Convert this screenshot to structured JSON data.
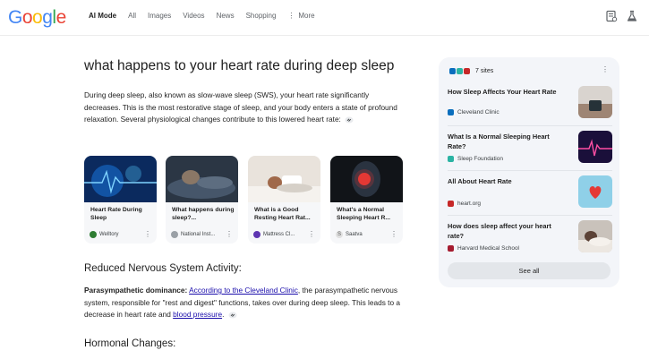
{
  "header": {
    "logo": "Google",
    "tabs": [
      {
        "label": "AI Mode",
        "active": true
      },
      {
        "label": "All"
      },
      {
        "label": "Images"
      },
      {
        "label": "Videos"
      },
      {
        "label": "News"
      },
      {
        "label": "Shopping"
      },
      {
        "label": "More"
      }
    ],
    "icons": [
      "notebook-icon",
      "labs-flask-icon"
    ]
  },
  "main": {
    "query": "what happens to your heart rate during deep sleep",
    "intro": "During deep sleep, also known as slow-wave sleep (SWS), your heart rate significantly decreases. This is the most restorative stage of sleep, and your body enters a state of profound relaxation. Several physiological changes contribute to this lowered heart rate:",
    "cards": [
      {
        "title": "Heart Rate During Sleep",
        "source": "Welltory",
        "fav_color": "#2e7d32"
      },
      {
        "title": "What happens during sleep?...",
        "source": "National Inst...",
        "fav_color": "#9aa0a6"
      },
      {
        "title": "What is a Good Resting Heart Rat...",
        "source": "Mattress Cl...",
        "fav_color": "#5e35b1"
      },
      {
        "title": "What's a Normal Sleeping Heart R...",
        "source": "Saatva",
        "fav_color": "#757575"
      }
    ],
    "section1": {
      "heading": "Reduced Nervous System Activity:",
      "bold": "Parasympathetic dominance:",
      "link1": "According to the Cleveland Clinic",
      "text1": ", the parasympathetic nervous system, responsible for \"rest and digest\" functions, takes over during deep sleep. This leads to a decrease in heart rate and ",
      "link2": "blood pressure",
      "text2": "."
    },
    "section2": {
      "heading": "Hormonal Changes:"
    }
  },
  "panel": {
    "sites_count": "7 sites",
    "sources": [
      {
        "title": "How Sleep Affects Your Heart Rate",
        "site": "Cleveland Clinic",
        "fav_color": "#0a6ebd"
      },
      {
        "title": "What Is a Normal Sleeping Heart Rate?",
        "site": "Sleep Foundation",
        "fav_color": "#2bb3a3"
      },
      {
        "title": "All About Heart Rate",
        "site": "heart.org",
        "fav_color": "#c62828"
      },
      {
        "title": "How does sleep affect your heart rate?",
        "site": "Harvard Medical School",
        "fav_color": "#a51c30"
      }
    ],
    "see_all": "See all"
  }
}
